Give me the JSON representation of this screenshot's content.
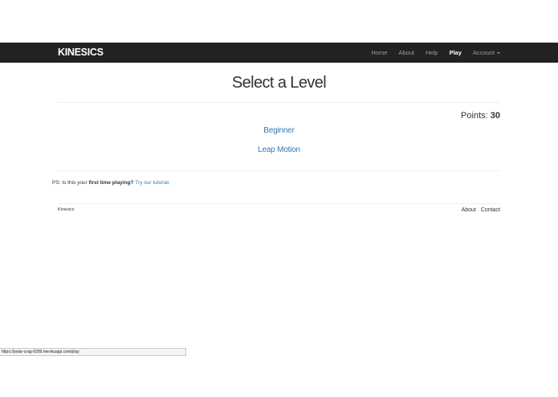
{
  "navbar": {
    "brand": "KINESICS",
    "items": [
      {
        "label": "Home"
      },
      {
        "label": "About"
      },
      {
        "label": "Help"
      },
      {
        "label": "Play",
        "active": true
      },
      {
        "label": "Account",
        "dropdown": true
      }
    ]
  },
  "main": {
    "title": "Select a Level",
    "points_label": "Points:",
    "points_value": "30",
    "levels": [
      {
        "label": "Beginner"
      },
      {
        "label": "Leap Motion"
      }
    ],
    "ps": {
      "prefix": "PS: Is this your ",
      "strong": "first time playing?",
      "link": "Try our tutorial",
      "suffix": "."
    }
  },
  "footer": {
    "brand": "Kinesics",
    "links": [
      {
        "label": "About"
      },
      {
        "label": "Contact"
      }
    ]
  },
  "status_bar": {
    "url": "https://polar-crag-9299.herokuapp.com/play"
  },
  "colors": {
    "navbar_bg": "#222222",
    "link_blue": "#337ab7",
    "nav_text": "#9d9d9d"
  }
}
